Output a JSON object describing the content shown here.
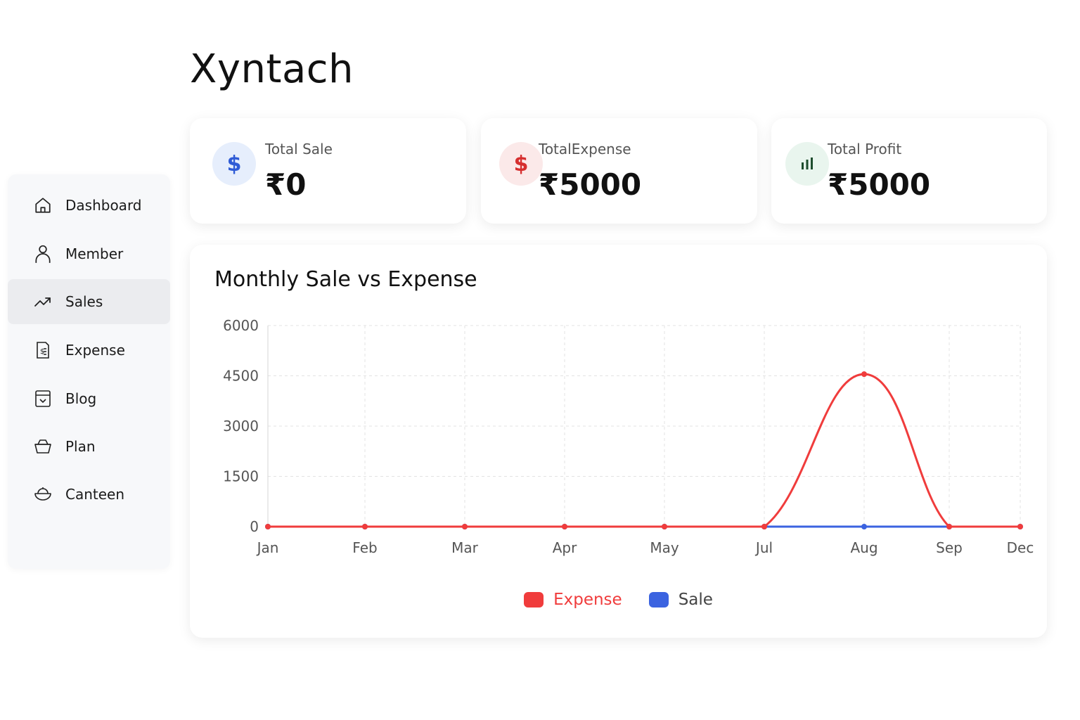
{
  "app": {
    "title": "Xyntach"
  },
  "sidebar": {
    "items": [
      {
        "label": "Dashboard",
        "icon": "home-icon",
        "active": false
      },
      {
        "label": "Member",
        "icon": "user-icon",
        "active": false
      },
      {
        "label": "Sales",
        "icon": "trend-icon",
        "active": true
      },
      {
        "label": "Expense",
        "icon": "receipt-icon",
        "active": false
      },
      {
        "label": "Blog",
        "icon": "archive-icon",
        "active": false
      },
      {
        "label": "Plan",
        "icon": "basket-icon",
        "active": false
      },
      {
        "label": "Canteen",
        "icon": "bowl-icon",
        "active": false
      }
    ]
  },
  "stats": {
    "total_sale": {
      "label": "Total Sale",
      "value": "₹0",
      "icon": "dollar-icon",
      "icon_color": "#2f5bd6",
      "icon_bg": "#e6eefc"
    },
    "total_expense": {
      "label": "TotalExpense",
      "value": "₹5000",
      "icon": "dollar-icon",
      "icon_color": "#d62f2f",
      "icon_bg": "#fbe9e9"
    },
    "total_profit": {
      "label": "Total Profit",
      "value": "₹5000",
      "icon": "bar-chart-icon",
      "icon_color": "#1e4d2e",
      "icon_bg": "#e9f5ee"
    }
  },
  "chart_data": {
    "type": "line",
    "title": "Monthly Sale vs Expense",
    "categories": [
      "Jan",
      "Feb",
      "Mar",
      "Apr",
      "May",
      "Jul",
      "Aug",
      "Sep",
      "Dec"
    ],
    "y_ticks": [
      "6000",
      "4500",
      "3000",
      "1500",
      "0"
    ],
    "ylim": [
      0,
      6000
    ],
    "grid": true,
    "legend_position": "bottom-center",
    "series": [
      {
        "name": "Expense",
        "color": "#f03c3c",
        "values": [
          0,
          0,
          0,
          0,
          0,
          0,
          4550,
          0,
          0
        ]
      },
      {
        "name": "Sale",
        "color": "#3b63e0",
        "values": [
          0,
          0,
          0,
          0,
          0,
          0,
          0,
          0,
          0
        ]
      }
    ]
  }
}
